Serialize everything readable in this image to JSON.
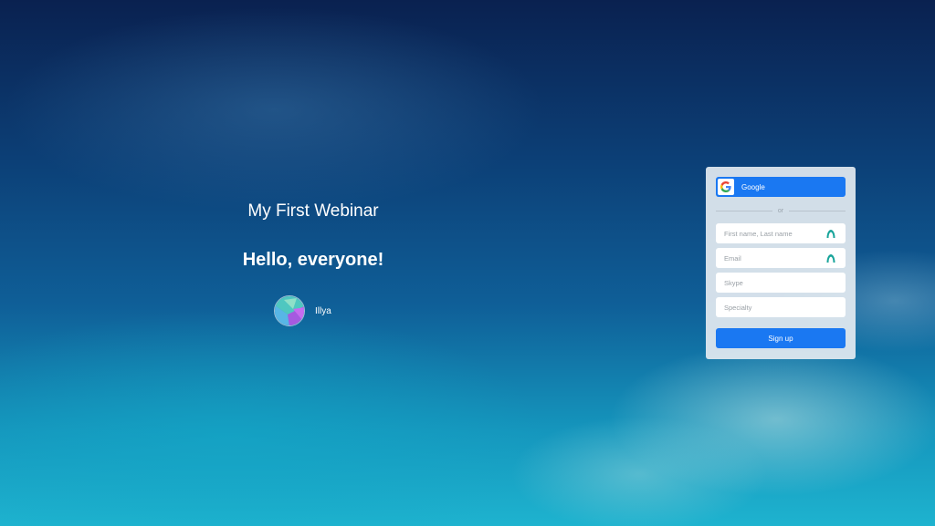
{
  "webinar": {
    "title": "My First Webinar",
    "greeting": "Hello, everyone!",
    "host_name": "Illya"
  },
  "signup": {
    "google_label": "Google",
    "divider_text": "or",
    "name_placeholder": "First name, Last name",
    "email_placeholder": "Email",
    "skype_placeholder": "Skype",
    "specialty_placeholder": "Specialty",
    "submit_label": "Sign up"
  },
  "colors": {
    "accent": "#1a78f2",
    "field_icon": "#18a49a",
    "card_bg": "#e2eaf0"
  },
  "icons": {
    "google": "google-logo-icon",
    "field_helper": "autofill-icon"
  }
}
